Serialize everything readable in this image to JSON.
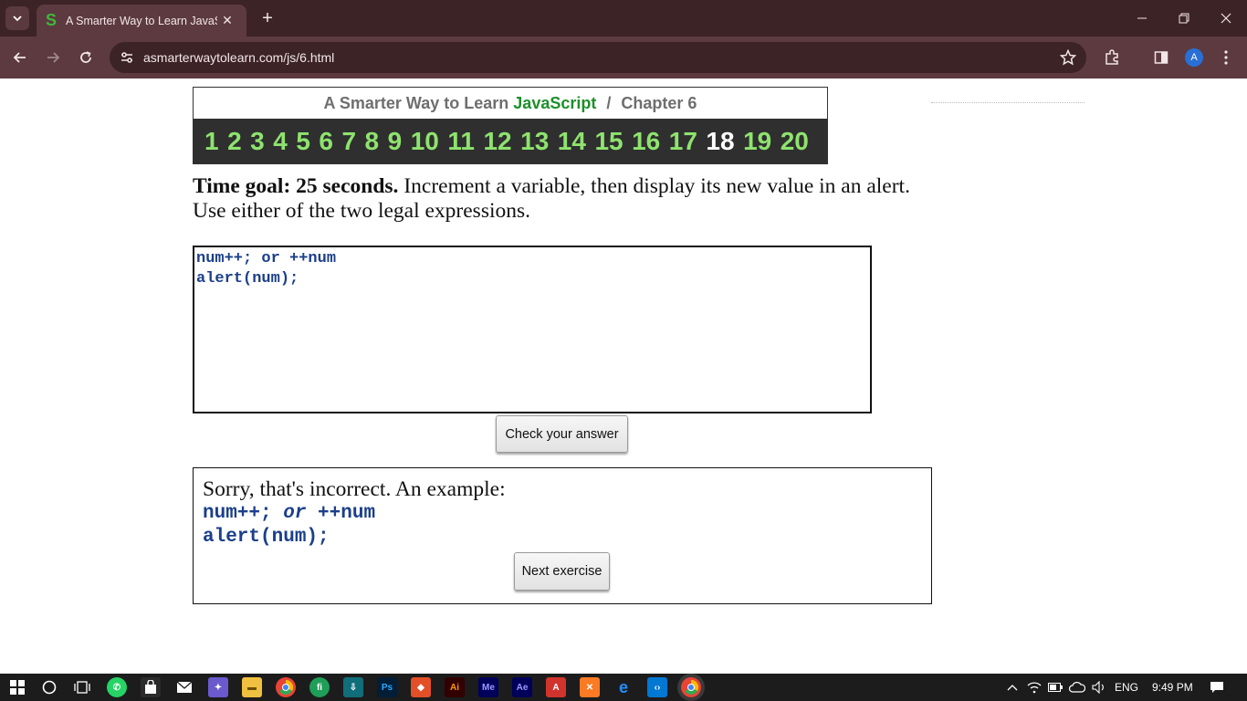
{
  "browser": {
    "tab_title": "A Smarter Way to Learn JavaScript",
    "tab_favicon": "S",
    "url": "asmarterwaytolearn.com/js/6.html",
    "profile_initial": "A"
  },
  "header": {
    "title_prefix": "A Smarter Way to Learn",
    "title_js": "JavaScript",
    "separator": "/",
    "chapter": "Chapter 6"
  },
  "chapters": [
    "1",
    "2",
    "3",
    "4",
    "5",
    "6",
    "7",
    "8",
    "9",
    "10",
    "11",
    "12",
    "13",
    "14",
    "15",
    "16",
    "17",
    "18",
    "19",
    "20"
  ],
  "current_chapter_index": 17,
  "instructions": {
    "goal": "Time goal: 25 seconds.",
    "text": "Increment a variable, then display its new value in an alert. Use either of the two legal expressions."
  },
  "code_input": {
    "value": "num++; or ++num\nalert(num);\n"
  },
  "check_button_label": "Check your answer",
  "feedback": {
    "message": "Sorry, that's incorrect. An example:",
    "example_line1_a": "num++; ",
    "example_line1_or": "or",
    "example_line1_b": " ++num",
    "example_line2": "alert(num);",
    "next_button_label": "Next exercise"
  },
  "taskbar": {
    "language": "ENG",
    "time": "9:49 PM"
  },
  "colors": {
    "chrome_dark": "#3c2326",
    "chrome_mid": "#5c3a3f",
    "chapter_link": "#8ee36e",
    "js_green": "#1d8f2a",
    "code_blue": "#1b3f8a"
  }
}
